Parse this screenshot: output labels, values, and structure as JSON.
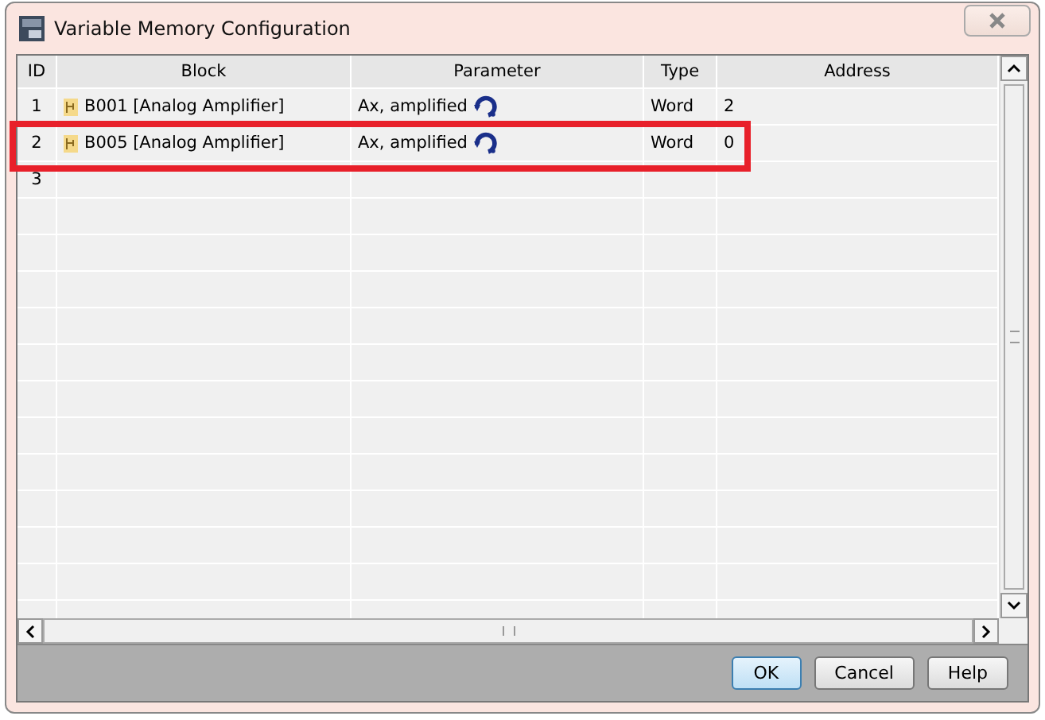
{
  "window": {
    "title": "Variable Memory Configuration"
  },
  "table": {
    "columns": [
      "ID",
      "Block",
      "Parameter",
      "Type",
      "Address"
    ],
    "rows": [
      {
        "id": "1",
        "block": "B001 [Analog Amplifier]",
        "parameter": "Ax, amplified",
        "type": "Word",
        "address": "2",
        "highlighted": false
      },
      {
        "id": "2",
        "block": "B005 [Analog Amplifier]",
        "parameter": "Ax, amplified",
        "type": "Word",
        "address": "0",
        "highlighted": true
      },
      {
        "id": "3",
        "highlighted": false
      }
    ]
  },
  "buttons": [
    {
      "label": "OK",
      "kind": "default"
    },
    {
      "label": "Cancel",
      "kind": "normal"
    },
    {
      "label": "Help",
      "kind": "normal"
    }
  ]
}
